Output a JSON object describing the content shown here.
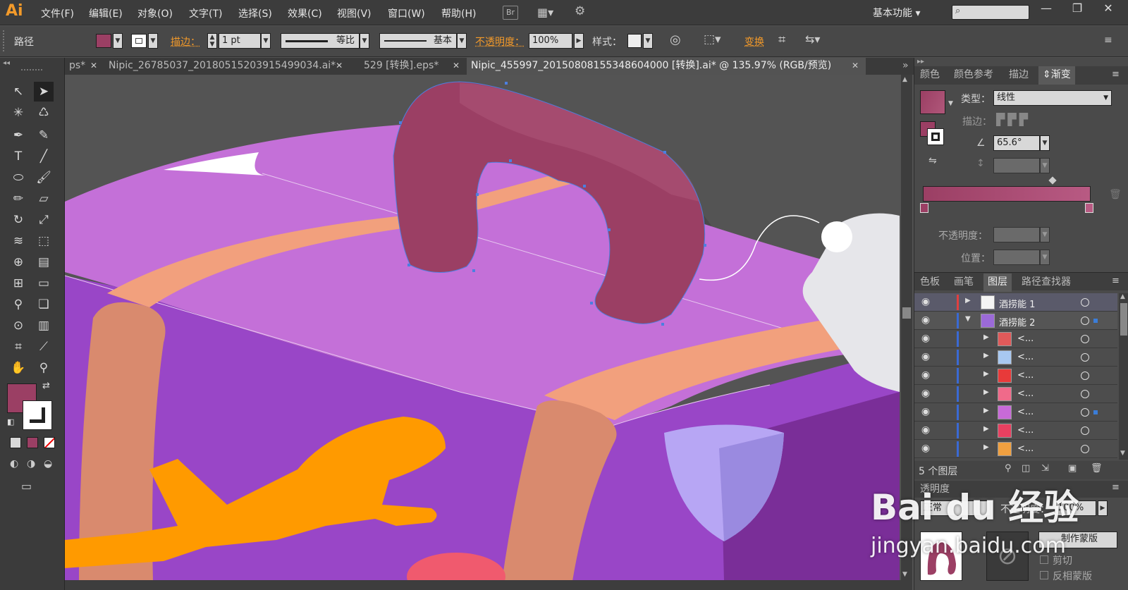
{
  "app": {
    "logo": "Ai"
  },
  "menu": [
    "文件(F)",
    "编辑(E)",
    "对象(O)",
    "文字(T)",
    "选择(S)",
    "效果(C)",
    "视图(V)",
    "窗口(W)",
    "帮助(H)"
  ],
  "menubar_icons": {
    "bridge": "Br"
  },
  "workspace": {
    "label": "基本功能"
  },
  "search": {
    "value": ""
  },
  "window_buttons": {
    "minimize": "—",
    "restore": "❐",
    "close": "✕"
  },
  "control": {
    "selection_type": "路径",
    "fill_color": "#9b3f64",
    "stroke_label": "描边：",
    "stroke_weight": "1 pt",
    "profile": "等比",
    "brush": "基本",
    "opacity_label": "不透明度：",
    "opacity_value": "100%",
    "style_label": "样式：",
    "transform_label": "变换"
  },
  "tabs": [
    {
      "label": "ps*",
      "close": "✕"
    },
    {
      "label": "Nipic_26785037_20180515203915499034.ai*",
      "close": "✕"
    },
    {
      "label": "529 [转换].eps*",
      "close": "✕"
    },
    {
      "label": "Nipic_455997_20150808155348604000 [转换].ai* @ 135.97% (RGB/预览)",
      "close": "✕",
      "active": true
    }
  ],
  "tab_overflow": "»",
  "colors": {
    "fill": "#9b3f64",
    "purple_top": "#c470d8",
    "purple_side": "#9946c7",
    "strap": "#f2a07d",
    "plane": "#ff9a00"
  },
  "gradient_panel": {
    "tabs": [
      "颜色",
      "颜色参考",
      "描边",
      "渐变"
    ],
    "active_tab": "渐变",
    "type_label": "类型：",
    "type_value": "线性",
    "stroke_label": "描边：",
    "angle_value": "65.6°",
    "opacity_label": "不透明度：",
    "position_label": "位置："
  },
  "layers_panel": {
    "tabs": [
      "色板",
      "画笔",
      "图层",
      "路径查找器"
    ],
    "active_tab": "图层",
    "rows": [
      {
        "name": "酒捞能 1",
        "expanded": false,
        "level": 0
      },
      {
        "name": "酒捞能 2",
        "expanded": true,
        "level": 0
      },
      {
        "name": "<...",
        "level": 1
      },
      {
        "name": "<...",
        "level": 1
      },
      {
        "name": "<...",
        "level": 1
      },
      {
        "name": "<...",
        "level": 1
      },
      {
        "name": "<...",
        "level": 1
      },
      {
        "name": "<...",
        "level": 1
      },
      {
        "name": "<...",
        "level": 1
      }
    ],
    "count_label": "5 个图层"
  },
  "transparency_panel": {
    "title": "透明度",
    "mode": "正常",
    "opacity_label": "不透明度：",
    "opacity_value": "100%",
    "make_mask": "制作蒙版",
    "clip": "剪切",
    "invert": "反相蒙版"
  },
  "watermark": {
    "brand": "Bai du 经验",
    "url": "jingyan.baidu.com"
  }
}
